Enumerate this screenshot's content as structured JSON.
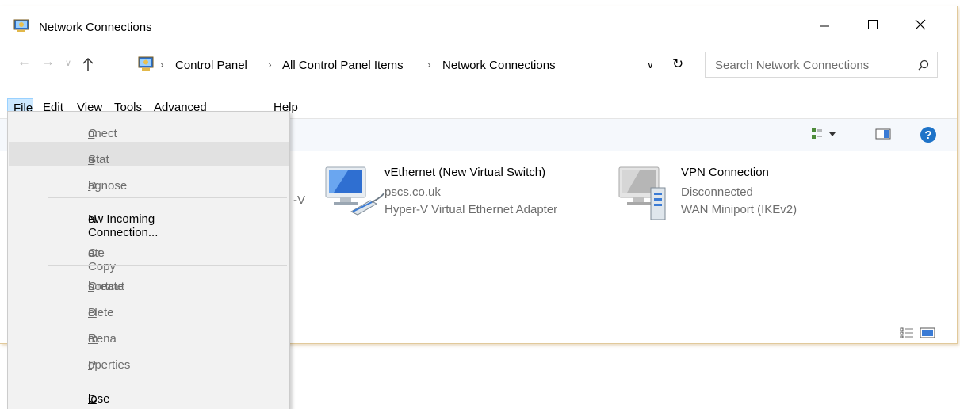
{
  "window": {
    "title": "Network Connections",
    "controls": [
      "minimize",
      "maximize",
      "close"
    ]
  },
  "nav": {
    "breadcrumbs": [
      "Control Panel",
      "All Control Panel Items",
      "Network Connections"
    ],
    "search_placeholder": "Search Network Connections"
  },
  "menubar": {
    "items": [
      {
        "label": "File",
        "accel": "F",
        "rest": "ile"
      },
      {
        "label": "Edit",
        "accel": "E",
        "rest": "dit"
      },
      {
        "label": "View",
        "accel": "V",
        "rest": "iew"
      },
      {
        "label": "Tools",
        "accel": "T",
        "rest": "ools"
      },
      {
        "label": "Advanced",
        "pre": "Adva",
        "accel": "n",
        "rest": "ced"
      },
      {
        "label": "Help",
        "accel": "H",
        "rest": "elp"
      }
    ]
  },
  "file_menu": {
    "items": [
      {
        "label": "Connect",
        "pre": "C",
        "accel": "o",
        "rest": "nnect",
        "enabled": false
      },
      {
        "label": "Status",
        "pre": "Stat",
        "accel": "u",
        "rest": "s",
        "enabled": false,
        "highlighted": true
      },
      {
        "label": "Diagnose",
        "pre": "D",
        "accel": "i",
        "rest": "agnose",
        "enabled": false
      },
      {
        "label": "New Incoming Connection...",
        "pre": "",
        "accel": "N",
        "rest": "ew Incoming Connection...",
        "enabled": true
      },
      {
        "label": "Create Copy",
        "pre": "Cr",
        "accel": "e",
        "rest": "ate Copy",
        "enabled": false
      },
      {
        "label": "Create shortcut",
        "pre": "Create ",
        "accel": "s",
        "rest": "hortcut",
        "enabled": false
      },
      {
        "label": "Delete",
        "pre": "",
        "accel": "D",
        "rest": "elete",
        "enabled": false
      },
      {
        "label": "Rename",
        "pre": "Rena",
        "accel": "m",
        "rest": "e",
        "enabled": false
      },
      {
        "label": "Properties",
        "pre": "P",
        "accel": "r",
        "rest": "operties",
        "enabled": false
      },
      {
        "label": "Close",
        "pre": "",
        "accel": "C",
        "rest": "lose",
        "enabled": true
      }
    ]
  },
  "connections": [
    {
      "name": "vEthernet (New Virtual Switch)",
      "status": "pscs.co.uk",
      "device": "Hyper-V Virtual Ethernet Adapter"
    },
    {
      "name": "VPN Connection",
      "status": "Disconnected",
      "device": "WAN Miniport (IKEv2)"
    }
  ],
  "partial_hidden_text": "-V",
  "colors": {
    "menu_highlight": "#cce8ff",
    "help_icon": "#1e73c8"
  }
}
